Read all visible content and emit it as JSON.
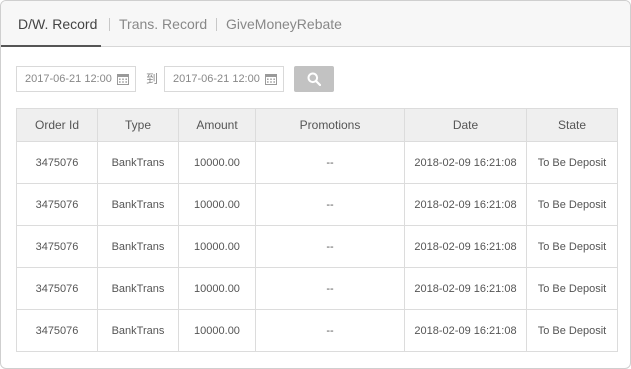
{
  "tabs": [
    {
      "label": "D/W. Record",
      "active": true
    },
    {
      "label": "Trans. Record",
      "active": false
    },
    {
      "label": "GiveMoneyRebate",
      "active": false
    }
  ],
  "filter": {
    "start_date": "2017-06-21 12:00",
    "end_date": "2017-06-21 12:00",
    "to_label": "到",
    "search_icon": "search-icon",
    "calendar_icon": "calendar-icon"
  },
  "table": {
    "headers": [
      "Order Id",
      "Type",
      "Amount",
      "Promotions",
      "Date",
      "State"
    ],
    "rows": [
      [
        "3475076",
        "BankTrans",
        "10000.00",
        "--",
        "2018-02-09 16:21:08",
        "To Be Deposit"
      ],
      [
        "3475076",
        "BankTrans",
        "10000.00",
        "--",
        "2018-02-09 16:21:08",
        "To Be Deposit"
      ],
      [
        "3475076",
        "BankTrans",
        "10000.00",
        "--",
        "2018-02-09 16:21:08",
        "To Be Deposit"
      ],
      [
        "3475076",
        "BankTrans",
        "10000.00",
        "--",
        "2018-02-09 16:21:08",
        "To Be Deposit"
      ],
      [
        "3475076",
        "BankTrans",
        "10000.00",
        "--",
        "2018-02-09 16:21:08",
        "To Be Deposit"
      ]
    ]
  },
  "colors": {
    "tab_active": "#444444",
    "tab_inactive": "#888888",
    "header_bg": "#efefef",
    "search_button": "#c2c2c2"
  }
}
